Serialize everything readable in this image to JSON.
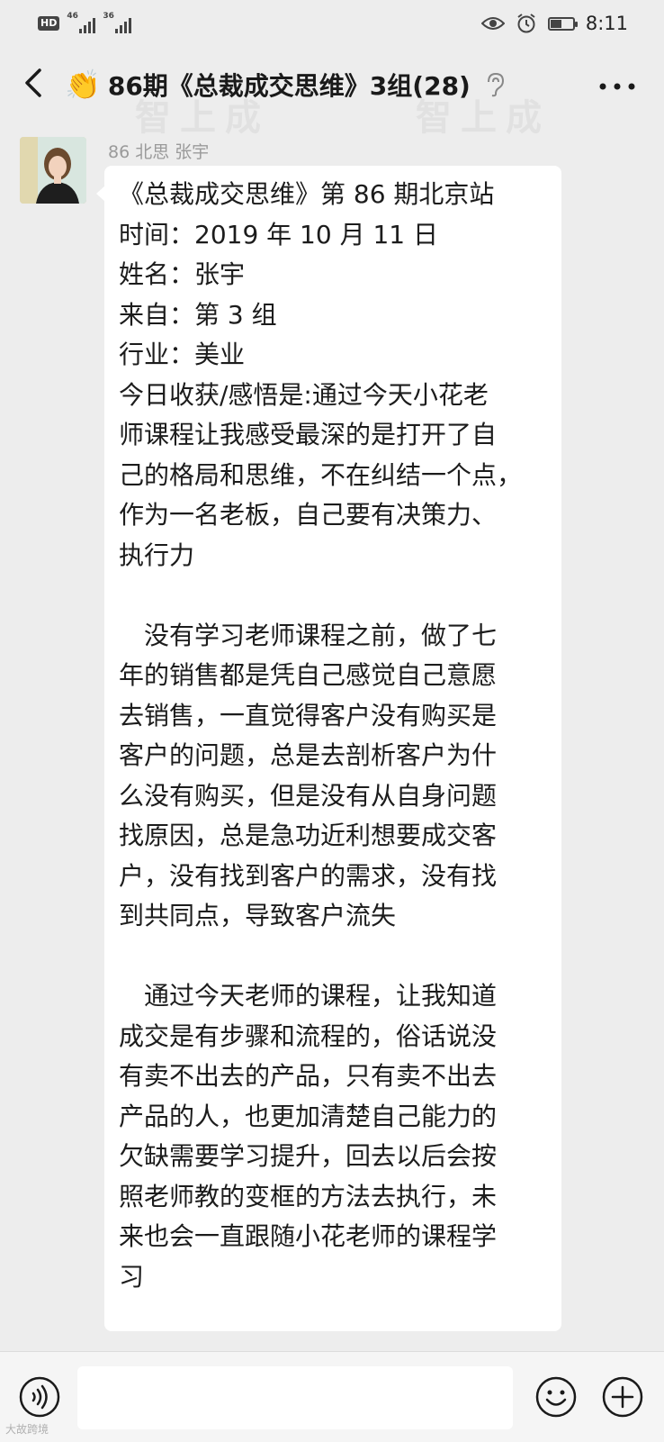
{
  "status_bar": {
    "hd": "HD",
    "net1": "46",
    "net2": "36",
    "time": "8:11",
    "battery_level": 0.55
  },
  "header": {
    "title": "86期《总裁成交思维》3组(28)",
    "back_icon": "chevron-left-icon",
    "more_icon": "more-dots-icon"
  },
  "watermark": {
    "text": "智上成"
  },
  "message": {
    "sender": "86 北思 张宇",
    "lines": [
      "《总裁成交思维》第 86 期北京站",
      "时间：2019 年 10 月 11 日",
      "姓名：张宇",
      "来自：第 3 组",
      "行业：美业",
      "今日收获/感悟是:通过今天小花老",
      "师课程让我感受最深的是打开了自",
      "己的格局和思维，不在纠结一个点，",
      "作为一名老板，自己要有决策力、",
      "执行力",
      "",
      "  没有学习老师课程之前，做了七",
      "年的销售都是凭自己感觉自己意愿",
      "去销售，一直觉得客户没有购买是",
      "客户的问题，总是去剖析客户为什",
      "么没有购买，但是没有从自身问题",
      "找原因，总是急功近利想要成交客",
      "户，没有找到客户的需求，没有找",
      "到共同点，导致客户流失",
      "",
      "  通过今天老师的课程，让我知道",
      "成交是有步骤和流程的，俗话说没",
      "有卖不出去的产品，只有卖不出去",
      "产品的人，也更加清楚自己能力的",
      "欠缺需要学习提升，回去以后会按",
      "照老师教的变框的方法去执行，未",
      "来也会一直跟随小花老师的课程学",
      "习"
    ]
  },
  "input_bar": {
    "voice_icon": "voice-icon",
    "emoji_icon": "emoji-icon",
    "plus_icon": "plus-icon"
  },
  "corner_mark": "大故跨境"
}
